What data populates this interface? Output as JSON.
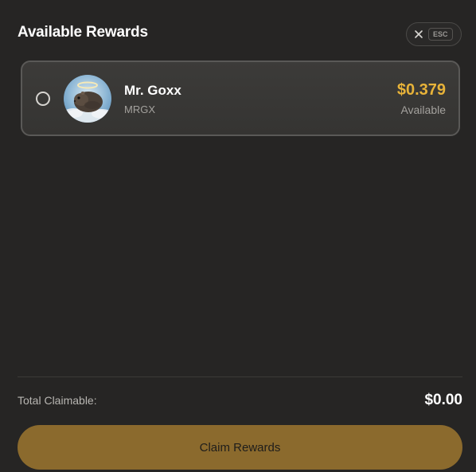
{
  "header": {
    "title": "Available Rewards",
    "close_icon": "close-icon",
    "esc_label": "ESC"
  },
  "rewards": [
    {
      "name": "Mr. Goxx",
      "symbol": "MRGX",
      "amount": "$0.379",
      "status": "Available",
      "selected": false,
      "avatar_icon": "hamster-angel-avatar"
    }
  ],
  "footer": {
    "total_label": "Total Claimable:",
    "total_value": "$0.00",
    "claim_label": "Claim Rewards"
  },
  "colors": {
    "background": "#262524",
    "card": "#3a3937",
    "accent_amount": "#e8b339",
    "claim_button": "#8b6a2d"
  }
}
